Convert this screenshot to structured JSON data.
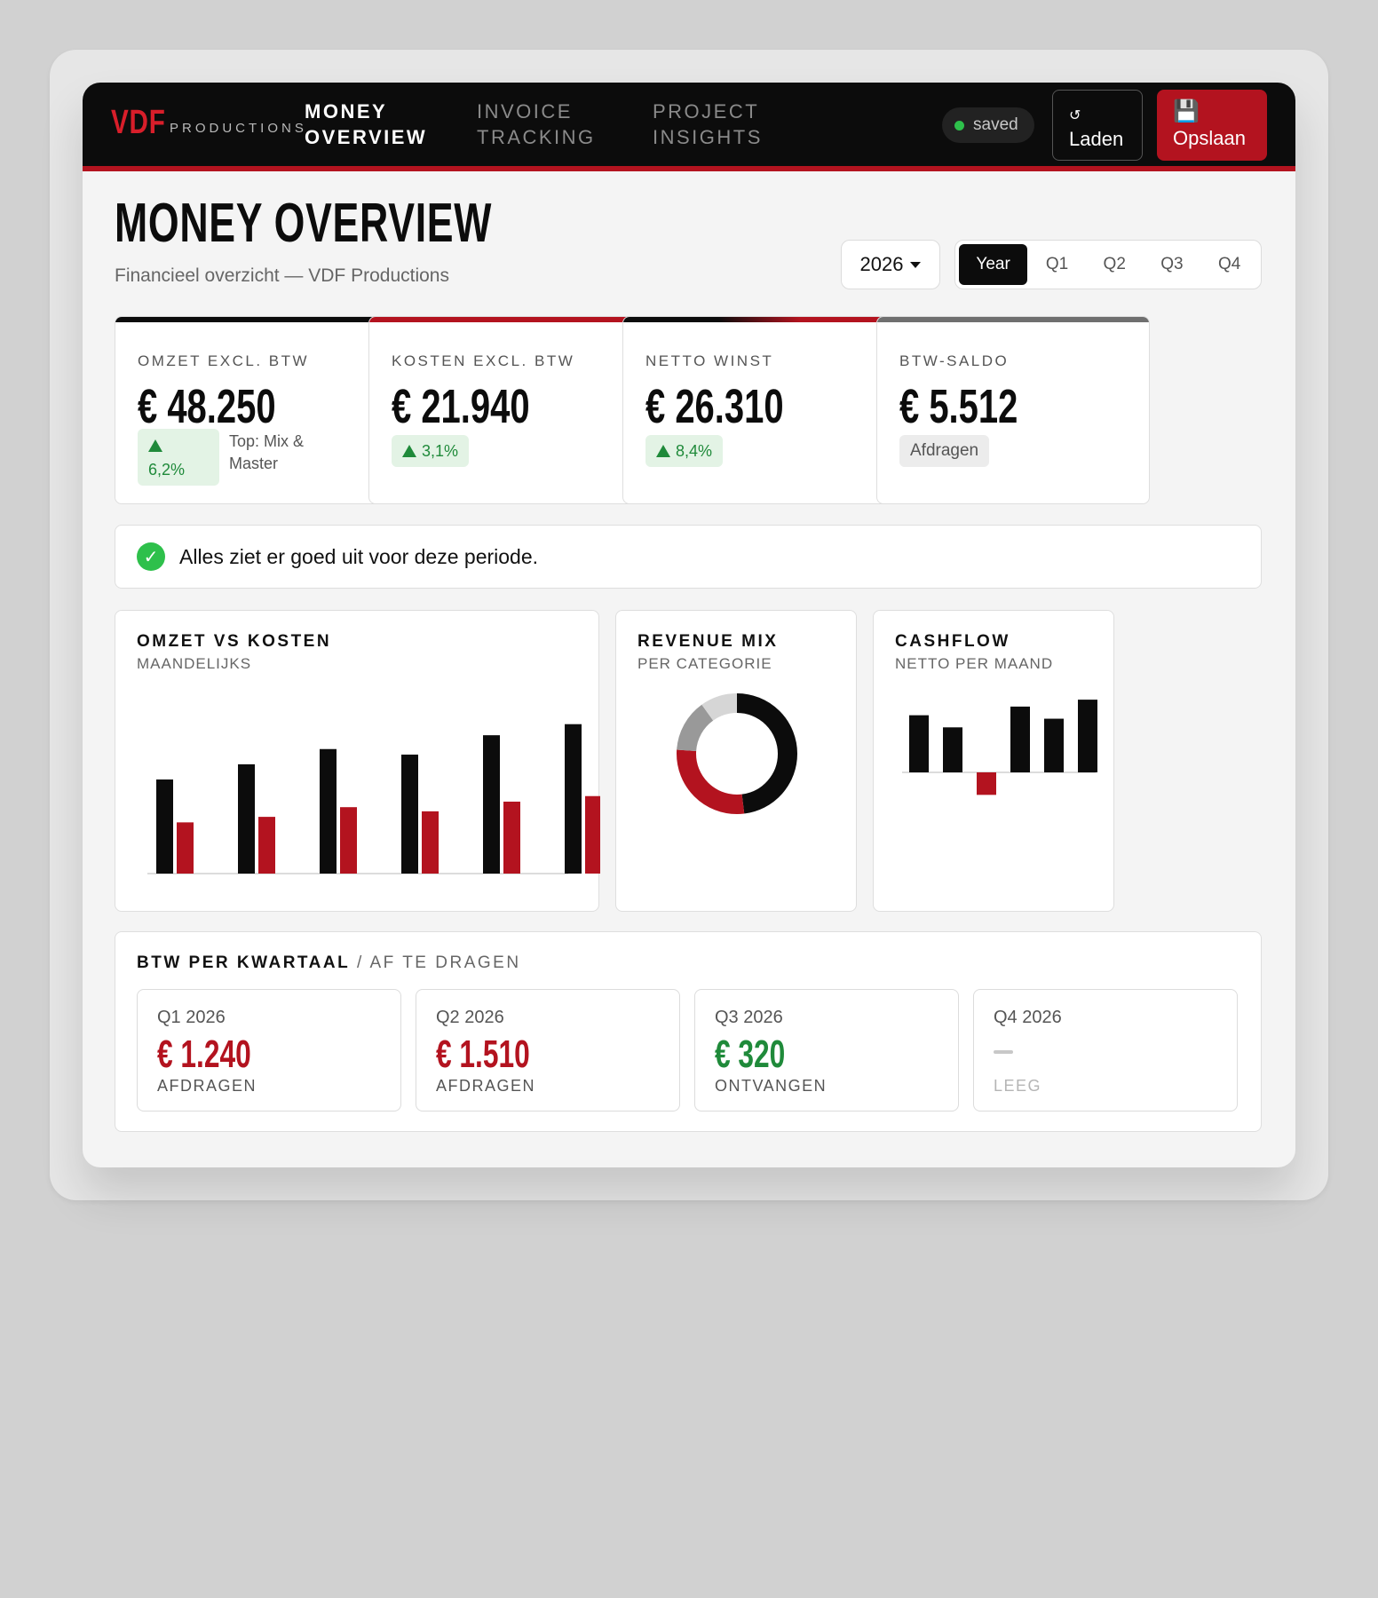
{
  "brand": {
    "mark": "VDF",
    "sub": "PRODUCTIONS",
    "accent": "#b3131f"
  },
  "nav": [
    {
      "line1": "MONEY",
      "line2": "OVERVIEW",
      "active": true
    },
    {
      "line1": "INVOICE",
      "line2": "TRACKING",
      "active": false
    },
    {
      "line1": "PROJECT",
      "line2": "INSIGHTS",
      "active": false
    }
  ],
  "sync": {
    "status": "saved",
    "load_icon": "↺",
    "load_label": "Laden",
    "save_icon": "💾",
    "save_label": "Opslaan"
  },
  "header": {
    "title": "MONEY OVERVIEW",
    "subtitle": "Financieel overzicht — VDF Productions"
  },
  "period": {
    "year": "2026",
    "tabs": [
      "Year",
      "Q1",
      "Q2",
      "Q3",
      "Q4"
    ],
    "selected": "Year"
  },
  "kpis": [
    {
      "label": "OMZET EXCL. BTW",
      "value": "€ 48.250",
      "delta": "6,2%",
      "note": "Top: Mix & Master",
      "accent": "#0c0c0c"
    },
    {
      "label": "KOSTEN EXCL. BTW",
      "value": "€ 21.940",
      "delta": "3,1%",
      "accent": "#b3131f"
    },
    {
      "label": "NETTO WINST",
      "value": "€ 26.310",
      "delta": "8,4%",
      "accent": "#0c0c0c"
    },
    {
      "label": "BTW-SALDO",
      "value": "€ 5.512",
      "badge": "Afdragen",
      "accent": "#6f6f6f"
    }
  ],
  "status": {
    "icon": "check-circle-icon",
    "text": "Alles ziet er goed uit voor deze periode."
  },
  "charts": {
    "revenue_vs_costs": {
      "title": "OMZET VS KOSTEN",
      "subtitle": "MAANDELIJKS"
    },
    "revenue_mix": {
      "title": "REVENUE MIX",
      "subtitle": "PER CATEGORIE"
    },
    "cashflow": {
      "title": "CASHFLOW",
      "subtitle": "NETTO PER MAAND"
    }
  },
  "chart_data": [
    {
      "type": "bar",
      "title": "OMZET VS KOSTEN",
      "subtitle": "MAANDELIJKS",
      "series": [
        {
          "values": [
            6.8,
            7.9,
            9.0,
            8.6,
            10.0,
            10.8
          ],
          "color": "#0c0c0c"
        },
        {
          "values": [
            3.7,
            4.1,
            4.8,
            4.5,
            5.2,
            5.6
          ],
          "color": "#b3131f"
        }
      ],
      "ylim": [
        0,
        12
      ],
      "grid": false
    },
    {
      "type": "pie",
      "title": "REVENUE MIX",
      "subtitle": "PER CATEGORIE",
      "values": [
        48,
        28,
        14,
        10
      ],
      "colors": [
        "#0c0c0c",
        "#b3131f",
        "#999999",
        "#d6d6d6"
      ]
    },
    {
      "type": "bar",
      "title": "CASHFLOW",
      "subtitle": "NETTO PER MAAND",
      "values": [
        3.3,
        2.6,
        -1.3,
        3.8,
        3.1,
        4.2
      ],
      "colors": {
        "positive": "#0c0c0c",
        "negative": "#b3131f"
      },
      "ylim": [
        -2,
        4.5
      ]
    }
  ],
  "btw": {
    "title": "BTW PER KWARTAAL",
    "sep": "/",
    "subtitle": "AF TE DRAGEN",
    "quarters": [
      {
        "label": "Q1 2026",
        "value": "€ 1.240",
        "status": "AFDRAGEN"
      },
      {
        "label": "Q2 2026",
        "value": "€ 1.510",
        "status": "AFDRAGEN"
      },
      {
        "label": "Q3 2026",
        "value": "€ 320",
        "status": "ONTVANGEN"
      },
      {
        "label": "Q4 2026",
        "value": "",
        "status": "LEEG"
      }
    ]
  }
}
